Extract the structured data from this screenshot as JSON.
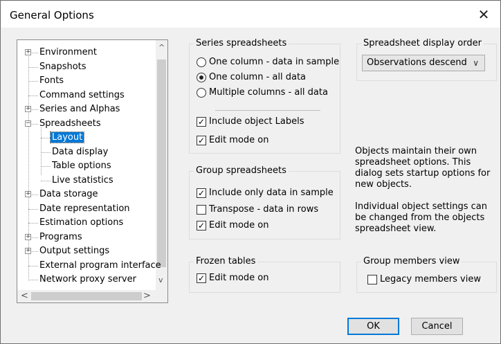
{
  "window": {
    "title": "General Options",
    "close_glyph": "✕"
  },
  "tree": {
    "items": [
      {
        "label": "Environment",
        "expander": "+"
      },
      {
        "label": "Snapshots"
      },
      {
        "label": "Fonts"
      },
      {
        "label": "Command settings"
      },
      {
        "label": "Series and Alphas",
        "expander": "+"
      },
      {
        "label": "Spreadsheets",
        "expander": "−"
      },
      {
        "label": "Layout",
        "selected": true
      },
      {
        "label": "Data display"
      },
      {
        "label": "Table options"
      },
      {
        "label": "Live statistics"
      },
      {
        "label": "Data storage",
        "expander": "+"
      },
      {
        "label": "Date representation"
      },
      {
        "label": "Estimation options"
      },
      {
        "label": "Programs",
        "expander": "+"
      },
      {
        "label": "Output settings",
        "expander": "+"
      },
      {
        "label": "External program interface"
      },
      {
        "label": "Network proxy server"
      }
    ]
  },
  "series_spreadsheets": {
    "title": "Series spreadsheets",
    "radios": [
      {
        "label": "One column - data in sample",
        "selected": false
      },
      {
        "label": "One column - all data",
        "selected": true
      },
      {
        "label": "Multiple columns - all data",
        "selected": false
      }
    ],
    "include_labels": {
      "label": "Include object Labels",
      "checked": true
    },
    "edit_mode": {
      "label": "Edit mode on",
      "checked": true
    }
  },
  "display_order": {
    "title": "Spreadsheet display order",
    "selected": "Observations descend"
  },
  "info_text_1": "Objects maintain their own spreadsheet options. This dialog sets startup options for new objects.",
  "info_text_2": "Individual object settings can be changed from the objects spreadsheet view.",
  "group_spreadsheets": {
    "title": "Group spreadsheets",
    "include_sample": {
      "label": "Include only data in sample",
      "checked": true
    },
    "transpose": {
      "label": "Transpose - data in rows",
      "checked": false
    },
    "edit_mode": {
      "label": "Edit mode on",
      "checked": true
    }
  },
  "frozen_tables": {
    "title": "Frozen tables",
    "edit_mode": {
      "label": "Edit mode on",
      "checked": true
    }
  },
  "group_members_view": {
    "title": "Group members view",
    "legacy": {
      "label": "Legacy members view",
      "checked": false
    }
  },
  "buttons": {
    "ok": "OK",
    "cancel": "Cancel"
  },
  "check_glyph": "✓",
  "colors": {
    "selection": "#0078d7",
    "default_button_border": "#0078d7"
  }
}
